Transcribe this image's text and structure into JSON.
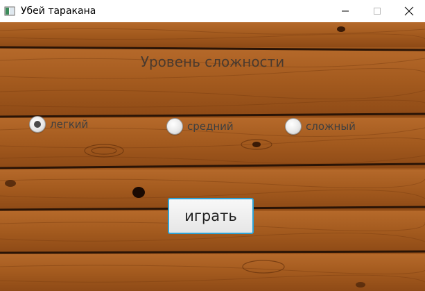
{
  "window": {
    "title": "Убей таракана",
    "icon": "java-app-icon",
    "controls": [
      "minimize-icon",
      "maximize-icon",
      "close-icon"
    ]
  },
  "main": {
    "heading": "Уровень сложности",
    "difficulty_options": [
      {
        "label": "легкий",
        "selected": true
      },
      {
        "label": "средний",
        "selected": false
      },
      {
        "label": "сложный",
        "selected": false
      }
    ],
    "play_button": "играть"
  },
  "colors": {
    "wood": "#a8601f",
    "text": "#4a3a2e",
    "button_border": "#2ea3d6"
  }
}
